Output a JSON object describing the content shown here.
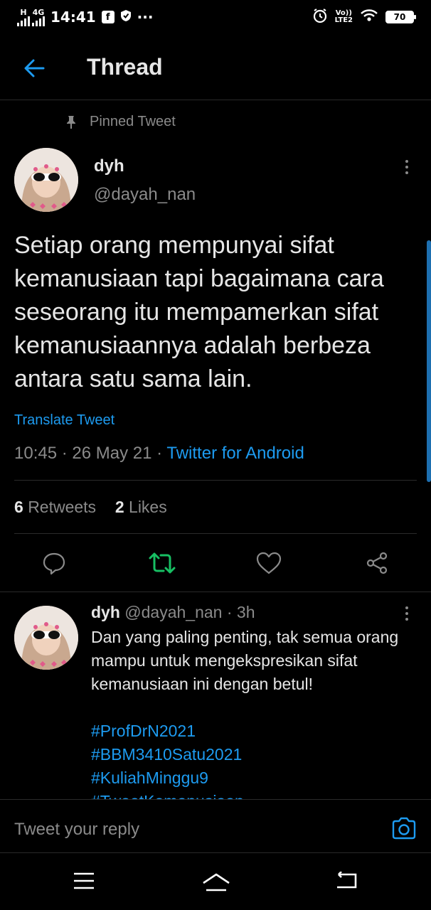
{
  "status_bar": {
    "time": "14:41",
    "network": "4G",
    "network_h": "H",
    "volte_top": "Vo))",
    "volte_bottom": "LTE2",
    "battery": "70",
    "fb_icon": "f",
    "more": "···"
  },
  "header": {
    "title": "Thread",
    "back_icon": "arrow-left-icon"
  },
  "pinned": {
    "label": "Pinned Tweet",
    "icon": "pin-icon"
  },
  "tweet": {
    "name": "dyh",
    "handle": "@dayah_nan",
    "text": "Setiap orang mempunyai sifat kemanusiaan tapi bagaimana cara seseorang itu mempamerkan sifat kemanusiaannya adalah berbeza antara satu sama lain.",
    "translate": "Translate Tweet",
    "time": "10:45",
    "date": "26 May 21",
    "source": "Twitter for Android",
    "retweets_count": "6",
    "retweets_label": "Retweets",
    "likes_count": "2",
    "likes_label": "Likes"
  },
  "actions": {
    "reply_icon": "comment-icon",
    "retweet_icon": "retweet-icon",
    "like_icon": "heart-icon",
    "share_icon": "share-icon",
    "retweet_color": "#17bf63"
  },
  "reply": {
    "name": "dyh",
    "handle": "@dayah_nan",
    "age": "3h",
    "text": "Dan yang paling penting, tak semua orang mampu untuk mengekspresikan sifat kemanusiaan ini dengan betul!",
    "hashtags": [
      "#ProfDrN2021",
      "#BBM3410Satu2021",
      "#KuliahMinggu9",
      "#TweetKemanusiaan"
    ]
  },
  "compose": {
    "placeholder": "Tweet your reply",
    "camera_icon": "camera-icon"
  },
  "colors": {
    "accent": "#1d9bf0",
    "background": "#000000",
    "muted": "#8a8a8a"
  }
}
